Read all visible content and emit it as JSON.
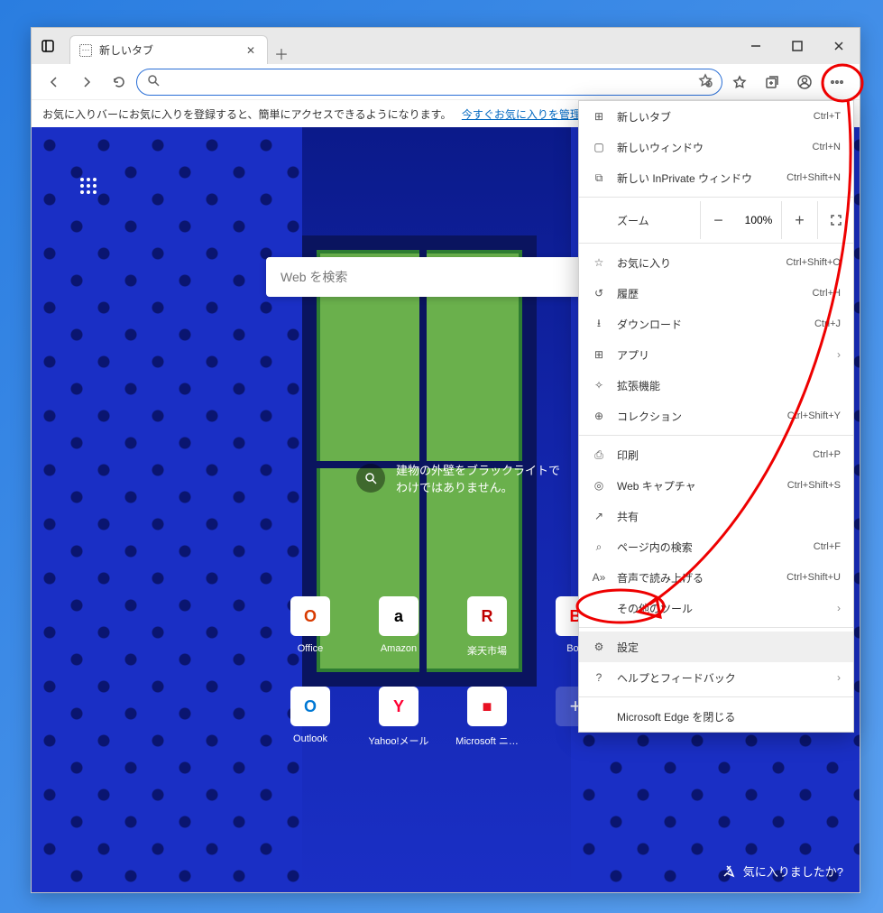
{
  "tab": {
    "title": "新しいタブ"
  },
  "favbar": {
    "text": "お気に入りバーにお気に入りを登録すると、簡単にアクセスできるようになります。",
    "link": "今すぐお気に入りを管理する"
  },
  "search": {
    "placeholder": "Web を検索"
  },
  "caption": {
    "line1": "建物の外壁をブラックライトで",
    "line2": "わけではありません。"
  },
  "quick_links": [
    {
      "label": "Office",
      "glyph": "O",
      "color": "#d83b01"
    },
    {
      "label": "Amazon",
      "glyph": "a",
      "color": "#000"
    },
    {
      "label": "楽天市場",
      "glyph": "R",
      "color": "#bf0000"
    },
    {
      "label": "Boo",
      "glyph": "B",
      "color": "#f00"
    },
    {
      "label": "Outlook",
      "glyph": "O",
      "color": "#0078d4"
    },
    {
      "label": "Yahoo!メール",
      "glyph": "Y",
      "color": "#ff0033"
    },
    {
      "label": "Microsoft ニ…",
      "glyph": "■",
      "color": "#e81123"
    }
  ],
  "like_prompt": "気に入りましたか?",
  "menu": {
    "zoom_label": "ズーム",
    "zoom_value": "100%",
    "items": [
      {
        "icon": "⊞",
        "label": "新しいタブ",
        "shortcut": "Ctrl+T"
      },
      {
        "icon": "▢",
        "label": "新しいウィンドウ",
        "shortcut": "Ctrl+N"
      },
      {
        "icon": "⧉",
        "label": "新しい InPrivate ウィンドウ",
        "shortcut": "Ctrl+Shift+N"
      },
      {
        "sep": true
      },
      {
        "zoom": true
      },
      {
        "sep": true
      },
      {
        "icon": "☆",
        "label": "お気に入り",
        "shortcut": "Ctrl+Shift+O"
      },
      {
        "icon": "↺",
        "label": "履歴",
        "shortcut": "Ctrl+H"
      },
      {
        "icon": "⭳",
        "label": "ダウンロード",
        "shortcut": "Ctrl+J"
      },
      {
        "icon": "⊞",
        "label": "アプリ",
        "chevron": true
      },
      {
        "icon": "✧",
        "label": "拡張機能"
      },
      {
        "icon": "⊕",
        "label": "コレクション",
        "shortcut": "Ctrl+Shift+Y"
      },
      {
        "sep": true
      },
      {
        "icon": "⎙",
        "label": "印刷",
        "shortcut": "Ctrl+P"
      },
      {
        "icon": "◎",
        "label": "Web キャプチャ",
        "shortcut": "Ctrl+Shift+S"
      },
      {
        "icon": "↗",
        "label": "共有"
      },
      {
        "icon": "⌕",
        "label": "ページ内の検索",
        "shortcut": "Ctrl+F"
      },
      {
        "icon": "A»",
        "label": "音声で読み上げる",
        "shortcut": "Ctrl+Shift+U"
      },
      {
        "icon": "",
        "label": "その他のツール",
        "chevron": true
      },
      {
        "sep": true
      },
      {
        "icon": "⚙",
        "label": "設定",
        "highlight": true
      },
      {
        "icon": "?",
        "label": "ヘルプとフィードバック",
        "chevron": true
      },
      {
        "sep": true
      },
      {
        "icon": "",
        "label": "Microsoft Edge を閉じる"
      }
    ]
  }
}
